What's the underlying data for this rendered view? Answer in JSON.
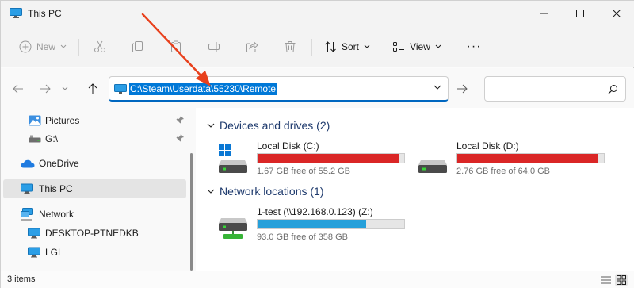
{
  "window": {
    "title": "This PC"
  },
  "toolbar": {
    "new_label": "New",
    "sort_label": "Sort",
    "view_label": "View",
    "more_label": "···"
  },
  "address": {
    "path": "C:\\Steam\\Userdata\\55230\\Remote"
  },
  "search": {
    "placeholder": ""
  },
  "navpane": {
    "items": [
      {
        "label": "Pictures",
        "icon": "pictures-icon",
        "pinned": true
      },
      {
        "label": "G:\\",
        "icon": "drive-icon",
        "pinned": true
      },
      {
        "label": "OneDrive",
        "icon": "onedrive-cloud-icon"
      },
      {
        "label": "This PC",
        "icon": "this-pc-icon",
        "selected": true
      },
      {
        "label": "Network",
        "icon": "network-icon"
      },
      {
        "label": "DESKTOP-PTNEDKB",
        "icon": "computer-icon"
      },
      {
        "label": "LGL",
        "icon": "computer-icon"
      }
    ]
  },
  "content": {
    "sections": [
      {
        "title": "Devices and drives (2)"
      },
      {
        "title": "Network locations (1)"
      }
    ],
    "drives": [
      {
        "name": "Local Disk (C:)",
        "free": "1.67 GB free of 55.2 GB",
        "used_fraction": 0.97,
        "bar_color": "#da2626",
        "windows_logo": true
      },
      {
        "name": "Local Disk (D:)",
        "free": "2.76 GB free of 64.0 GB",
        "used_fraction": 0.96,
        "bar_color": "#da2626",
        "windows_logo": false
      },
      {
        "name": "1-test (\\\\192.168.0.123) (Z:)",
        "free": "93.0 GB free of 358 GB",
        "used_fraction": 0.74,
        "bar_color": "#26a0da",
        "network": true
      }
    ]
  },
  "statusbar": {
    "text": "3 items"
  },
  "colors": {
    "accent": "#0067c0",
    "selection": "#0078d7",
    "annotation_arrow": "#e8401c",
    "drive_full": "#da2626",
    "drive_normal": "#26a0da"
  }
}
